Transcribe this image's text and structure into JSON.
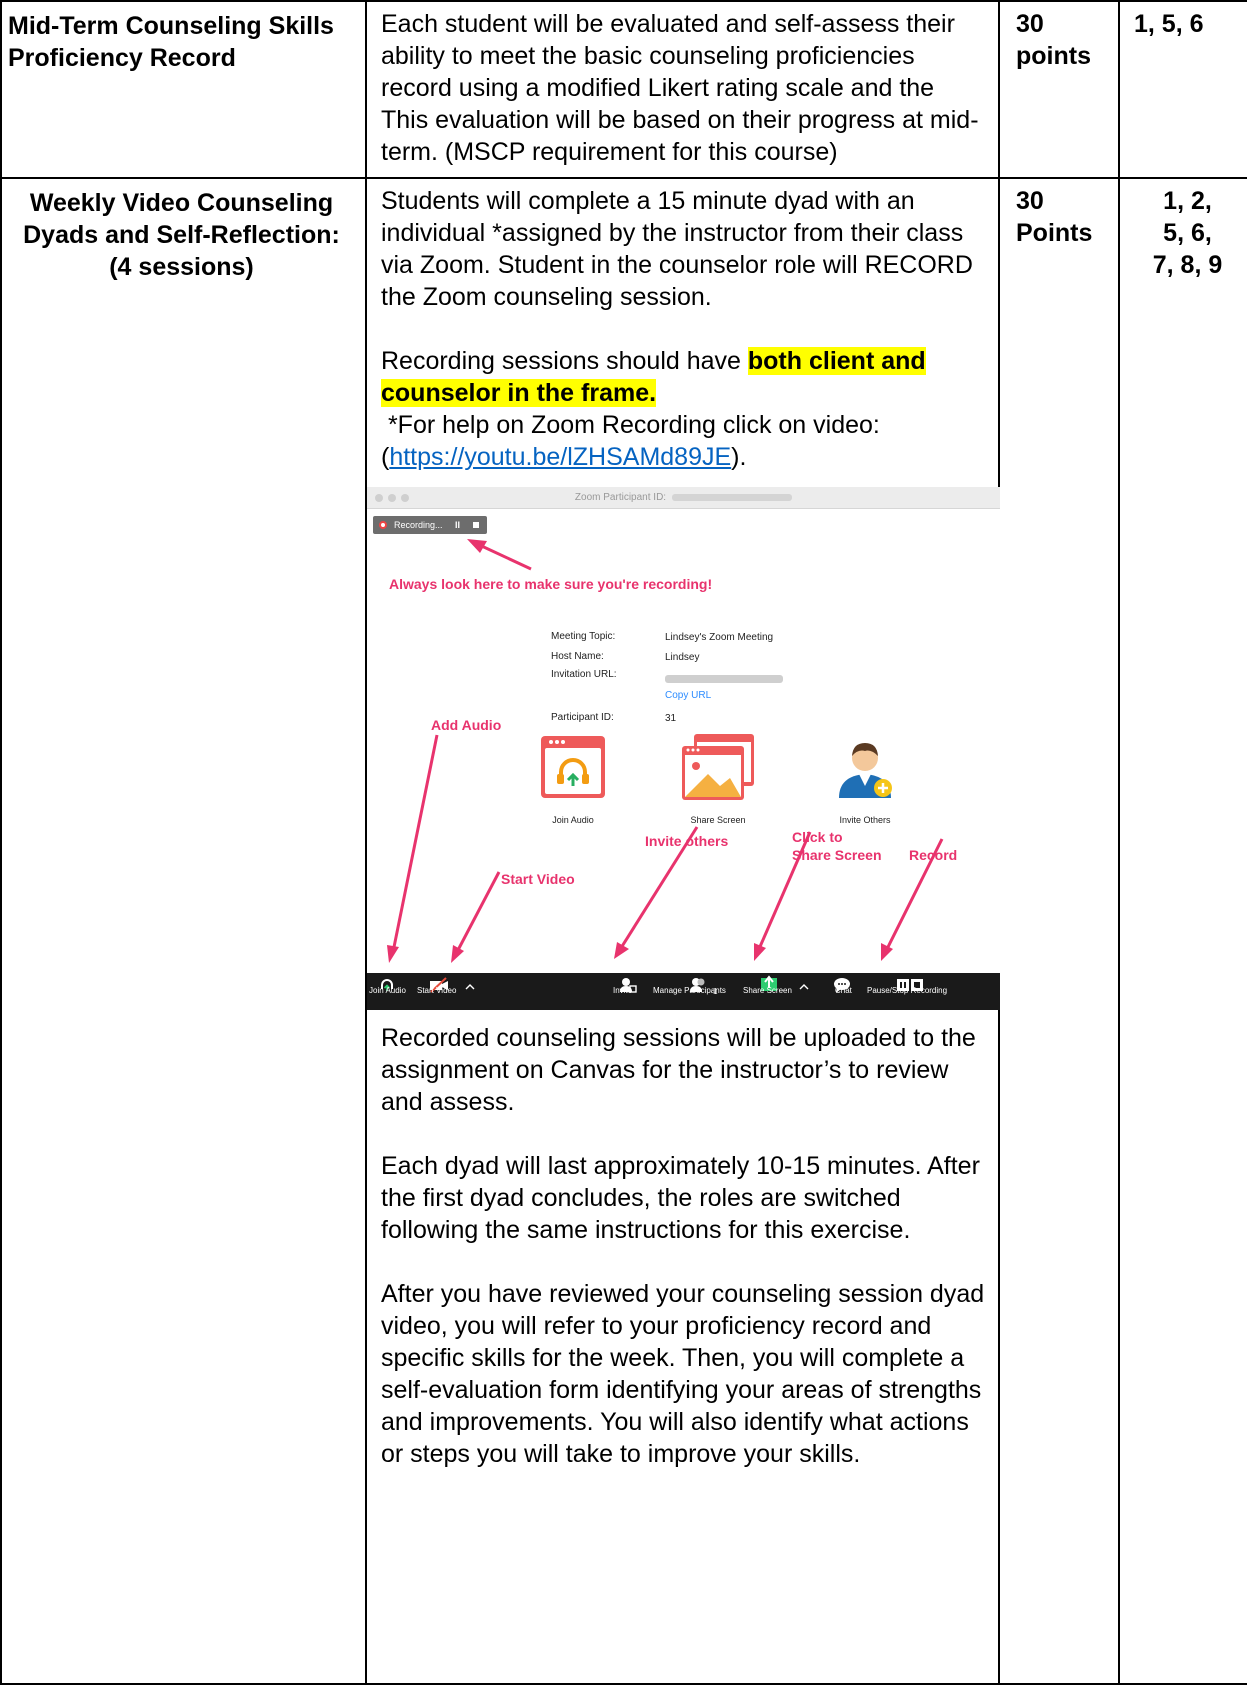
{
  "row1": {
    "title": "Mid-Term Counseling Skills Proficiency Record",
    "description": "Each student will be evaluated and self-assess their ability to meet the basic counseling proficiencies record using a modified Likert rating scale and the This evaluation will be based on their progress at mid-term.  (MSCP requirement for this course)",
    "points": "30 points",
    "objectives": "1, 5, 6"
  },
  "row2": {
    "title_line1": "Weekly Video Counseling",
    "title_line2": "Dyads and Self-Reflection:",
    "title_line3": "(4 sessions)",
    "para1": "Students will complete a 15 minute dyad with an individual *assigned by the instructor from their class via Zoom. Student in the counselor role will RECORD the Zoom counseling session.",
    "para2_plain": "Recording sessions should have ",
    "para2_highlight": "both client and counselor in the frame.",
    "para3": " *For help on Zoom Recording click on video:",
    "link_open": "(",
    "link_text": "https://youtu.be/lZHSAMd89JE",
    "link_close": ").",
    "para4": "Recorded counseling sessions will be uploaded to the assignment on Canvas for the instructor’s to review and assess.",
    "para5": "Each dyad will last approximately 10-15 minutes.  After the first dyad concludes, the roles are switched following the same instructions for this exercise.",
    "para6": "After you have reviewed your counseling session dyad video, you will refer to your proficiency record and specific skills for the week. Then, you will complete a self-evaluation form identifying your areas of strengths and improvements. You will also identify what actions or steps you will take to improve your skills.",
    "points_line1": "30",
    "points_line2": "Points",
    "objectives_line1": "1, 2,",
    "objectives_line2": "5, 6,",
    "objectives_line3": "7, 8, 9"
  },
  "zoom": {
    "window_title": "Zoom Participant ID:",
    "recording_label": "Recording...",
    "pause_glyph": "II",
    "ann_recording": "Always look here to make sure you're recording!",
    "meeting_topic_label": "Meeting Topic:",
    "meeting_topic_value": "Lindsey's Zoom Meeting",
    "host_label": "Host Name:",
    "host_value": "Lindsey",
    "invitation_label": "Invitation URL:",
    "copy_url": "Copy URL",
    "participant_label": "Participant ID:",
    "participant_value": "31",
    "ann_add_audio": "Add Audio",
    "tile_join_audio": "Join Audio",
    "tile_share_screen": "Share Screen",
    "tile_invite_others": "Invite Others",
    "ann_invite_others": "Invite others",
    "ann_click_line1": "Click to",
    "ann_click_line2": "Share Screen",
    "ann_record": "Record",
    "ann_start_video": "Start Video",
    "tb_join_audio": "Join Audio",
    "tb_start_video": "Start Video",
    "tb_invite": "Invite",
    "tb_manage": "Manage Participants",
    "tb_participant_count": "1",
    "tb_share": "Share Screen",
    "tb_chat": "Chat",
    "tb_pause_stop": "Pause/Stop Recording",
    "colors": {
      "annotation": "#e8336d",
      "toolbar": "#1a1a1a",
      "zoom_blue": "#2d8cff",
      "tile_red": "#ee5a5a"
    }
  },
  "highlight_color": "#ffff00",
  "link_color": "#0563c1"
}
